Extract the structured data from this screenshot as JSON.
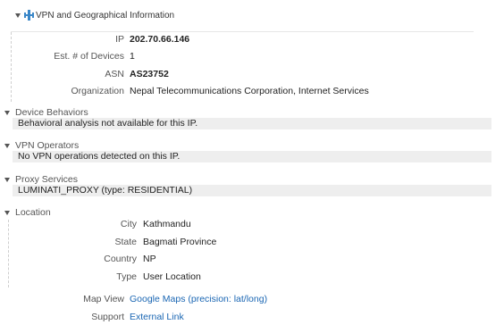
{
  "panel": {
    "title": "VPN and Geographical Information",
    "icon": "network-icon",
    "rows": [
      {
        "label": "IP",
        "value": "202.70.66.146"
      },
      {
        "label": "Est. # of Devices",
        "value": "1"
      },
      {
        "label": "ASN",
        "value": "AS23752"
      },
      {
        "label": "Organization",
        "value": "Nepal Telecommunications Corporation, Internet Services"
      }
    ]
  },
  "device_behaviors": {
    "title": "Device Behaviors",
    "text": "Behavioral analysis not available for this IP."
  },
  "vpn_operators": {
    "title": "VPN Operators",
    "text": "No VPN operations detected on this IP."
  },
  "proxy_services": {
    "title": "Proxy Services",
    "text": "LUMINATI_PROXY (type: RESIDENTIAL)"
  },
  "location": {
    "title": "Location",
    "rows": [
      {
        "label": "City",
        "value": "Kathmandu"
      },
      {
        "label": "State",
        "value": "Bagmati Province"
      },
      {
        "label": "Country",
        "value": "NP"
      },
      {
        "label": "Type",
        "value": "User Location"
      }
    ]
  },
  "links": {
    "map_view_label": "Map View",
    "map_view_link": "Google Maps (precision: lat/long)",
    "support_label": "Support",
    "support_link": "External Link"
  },
  "colors": {
    "link": "#1a66b3",
    "bar": "#eeeeee",
    "icon": "#3a87c8"
  }
}
